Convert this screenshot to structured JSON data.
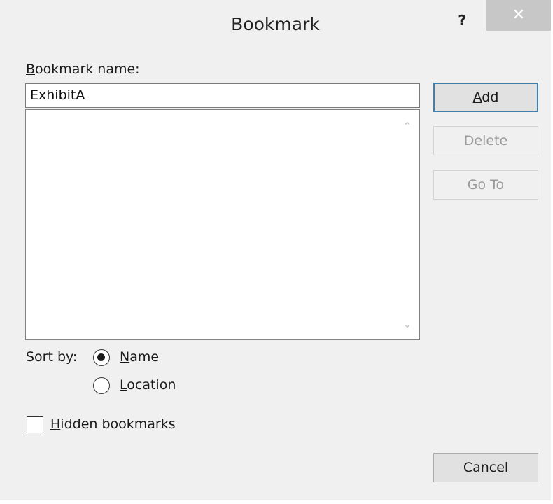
{
  "window": {
    "title": "Bookmark",
    "help_glyph": "?",
    "close_glyph": "✕"
  },
  "bookmark_name": {
    "label_accel": "B",
    "label_rest": "ookmark name:",
    "value": "ExhibitA"
  },
  "bookmark_list": {
    "items": [],
    "scroll_up_glyph": "⌃",
    "scroll_down_glyph": "⌄"
  },
  "buttons": {
    "add_accel": "A",
    "add_rest": "dd",
    "delete": "Delete",
    "goto": "Go To",
    "cancel": "Cancel"
  },
  "sort": {
    "label": "Sort by:",
    "selected": "Name",
    "name_accel": "N",
    "name_rest": "ame",
    "location_accel": "L",
    "location_rest": "ocation"
  },
  "hidden_bookmarks": {
    "checked": false,
    "label_accel": "H",
    "label_rest": "idden bookmarks"
  },
  "colors": {
    "dialog_bg": "#f0f0f0",
    "close_bg": "#c7c7c7",
    "default_button_border": "#3c7fb1",
    "disabled_text": "#9b9b9b"
  }
}
